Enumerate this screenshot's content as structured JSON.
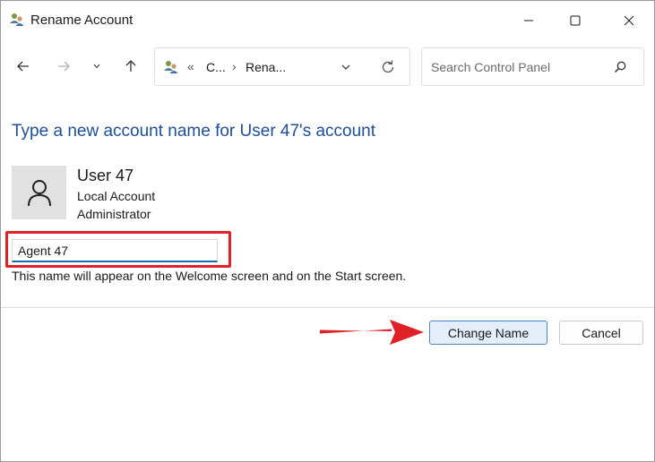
{
  "window": {
    "title": "Rename Account"
  },
  "address_bar": {
    "overflow": "«",
    "crumb_1": "C...",
    "separator": "›",
    "crumb_2": "Rena..."
  },
  "search": {
    "placeholder": "Search Control Panel"
  },
  "content": {
    "heading": "Type a new account name for User 47's account",
    "user_name": "User 47",
    "account_type": "Local Account",
    "account_role": "Administrator",
    "new_name_value": "Agent 47",
    "hint": "This name will appear on the Welcome screen and on the Start screen."
  },
  "buttons": {
    "change_name": "Change Name",
    "cancel": "Cancel"
  },
  "colors": {
    "heading": "#1e4e9c",
    "highlight_box": "#e02127",
    "annotation_arrow": "#e02127",
    "primary_button_bg": "#e3eef9",
    "input_underline": "#1b6ab3"
  }
}
